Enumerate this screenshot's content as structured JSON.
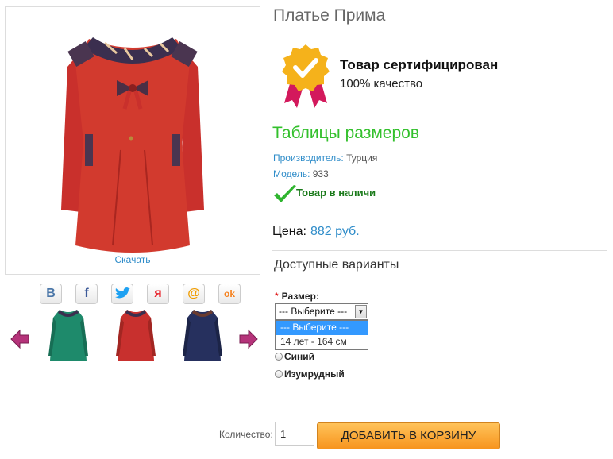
{
  "product": {
    "title": "Платье Прима",
    "download_label": "Скачать",
    "thumbnails": [
      {
        "color": "#1e8a6b",
        "icon": "dress-thumbnail-emerald"
      },
      {
        "color": "#c8302e",
        "icon": "dress-thumbnail-red"
      },
      {
        "color": "#26305e",
        "icon": "dress-thumbnail-navy"
      }
    ]
  },
  "social": [
    {
      "name": "vk-icon",
      "glyph": "В",
      "color": "#4a76a8"
    },
    {
      "name": "facebook-icon",
      "glyph": "f",
      "color": "#3b5998"
    },
    {
      "name": "twitter-icon",
      "glyph": "t",
      "color": "#1da1f2"
    },
    {
      "name": "moikrug-icon",
      "glyph": "я",
      "color": "#e8232b"
    },
    {
      "name": "mailru-icon",
      "glyph": "@",
      "color": "#f09c00"
    },
    {
      "name": "odnoklassniki-icon",
      "glyph": "ok",
      "color": "#f58220"
    }
  ],
  "certificate": {
    "title": "Товар сертифицирован",
    "subtitle": "100% качество",
    "badge_color": "#f5b21b",
    "ribbon_color": "#d3195c"
  },
  "sizes_link": "Таблицы размеров",
  "meta": {
    "manufacturer_label": "Производитель:",
    "manufacturer_value": "Турция",
    "model_label": "Модель:",
    "model_value": "933"
  },
  "stock_text": "Товар в наличи",
  "price": {
    "label": "Цена:",
    "value": "882 руб."
  },
  "variants": {
    "heading": "Доступные варианты",
    "required_mark": "*",
    "size_label": "Размер:",
    "select_value": "--- Выберите ---",
    "options": [
      "--- Выберите ---",
      "14 лет - 164 см"
    ],
    "colors": [
      "Синий",
      "Изумрудный"
    ]
  },
  "cart": {
    "qty_label": "Количество:",
    "qty_value": "1",
    "button_label": "ДОБАВИТЬ В КОРЗИНУ"
  },
  "colors": {
    "accent_blue": "#2e8cc9",
    "green": "#33c02c",
    "orange": "#f7941d",
    "dress_red": "#d23a2e"
  }
}
